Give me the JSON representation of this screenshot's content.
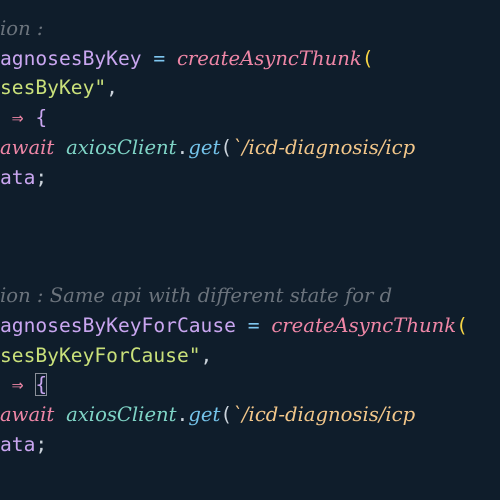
{
  "colors": {
    "background": "#0f1d2b",
    "comment": "#6b737c",
    "variable": "#c9a6f0",
    "operator": "#7fc7f0",
    "function": "#ee86a6",
    "paren": "#f7d545",
    "string": "#c9e07a",
    "keyword": "#ee86a6",
    "object": "#7fd4c6",
    "method": "#74c3ea",
    "template": "#f3c78a",
    "punct": "#cbd3db"
  },
  "lines": [
    [
      {
        "text": "ion : ",
        "role": "comment",
        "italic": true
      }
    ],
    [
      {
        "text": "agnosesByKey",
        "role": "variable"
      },
      {
        "text": " = ",
        "role": "operator"
      },
      {
        "text": "createAsyncThunk",
        "role": "function",
        "italic": true
      },
      {
        "text": "(",
        "role": "paren"
      }
    ],
    [
      {
        "text": "sesByKey\"",
        "role": "string"
      },
      {
        "text": ",",
        "role": "punct"
      }
    ],
    [
      {
        "text": " ⇒ ",
        "role": "function"
      },
      {
        "text": "{",
        "role": "variable"
      }
    ],
    [
      {
        "text": "await",
        "role": "keyword",
        "italic": true
      },
      {
        "text": " ",
        "role": "punct"
      },
      {
        "text": "axiosClient",
        "role": "object",
        "italic": true
      },
      {
        "text": ".",
        "role": "punct"
      },
      {
        "text": "get",
        "role": "method",
        "italic": true
      },
      {
        "text": "(",
        "role": "punct"
      },
      {
        "text": "`/icd-diagnosis/icp",
        "role": "template",
        "italic": true
      }
    ],
    [
      {
        "text": "ata",
        "role": "variable"
      },
      {
        "text": ";",
        "role": "punct"
      }
    ],
    [],
    [],
    [],
    [
      {
        "text": "ion : Same api with different state for d",
        "role": "comment",
        "italic": true
      }
    ],
    [
      {
        "text": "agnosesByKeyForCause",
        "role": "variable"
      },
      {
        "text": " = ",
        "role": "operator"
      },
      {
        "text": "createAsyncThunk",
        "role": "function",
        "italic": true
      },
      {
        "text": "(",
        "role": "paren"
      }
    ],
    [
      {
        "text": "sesByKeyForCause\"",
        "role": "string"
      },
      {
        "text": ",",
        "role": "punct"
      }
    ],
    [
      {
        "text": " ⇒ ",
        "role": "function"
      },
      {
        "text": "{",
        "role": "variable",
        "highlight": true
      }
    ],
    [
      {
        "text": "await",
        "role": "keyword",
        "italic": true
      },
      {
        "text": " ",
        "role": "punct"
      },
      {
        "text": "axiosClient",
        "role": "object",
        "italic": true
      },
      {
        "text": ".",
        "role": "punct"
      },
      {
        "text": "get",
        "role": "method",
        "italic": true
      },
      {
        "text": "(",
        "role": "punct"
      },
      {
        "text": "`/icd-diagnosis/icp",
        "role": "template",
        "italic": true
      }
    ],
    [
      {
        "text": "ata",
        "role": "variable"
      },
      {
        "text": ";",
        "role": "punct"
      }
    ]
  ]
}
